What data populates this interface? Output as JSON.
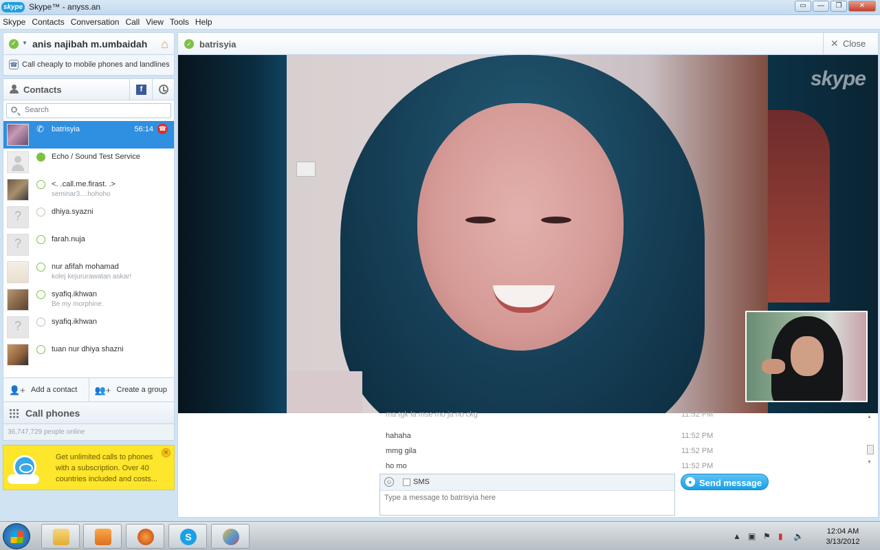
{
  "window": {
    "title": "Skype™ - anyss.an",
    "logo_text": "skype"
  },
  "menu": [
    "Skype",
    "Contacts",
    "Conversation",
    "Call",
    "View",
    "Tools",
    "Help"
  ],
  "profile": {
    "name": "anis najibah m.umbaidah"
  },
  "promo_call": {
    "text": "Call cheaply to mobile phones and landlines"
  },
  "contacts": {
    "label": "Contacts",
    "search_placeholder": "Search",
    "items": [
      {
        "name": "batrisyia",
        "mood": "",
        "timer": "56:14",
        "active": true,
        "avatar": "photo1",
        "status": "in-call"
      },
      {
        "name": "Echo / Sound Test Service",
        "mood": "",
        "avatar": "echo",
        "status": "online"
      },
      {
        "name": "<. .call.me.firast. .>",
        "mood": "seminar3....hohoho",
        "avatar": "photo2",
        "status": "offline"
      },
      {
        "name": "dhiya.syazni",
        "mood": "",
        "avatar": "q",
        "status": "unknown"
      },
      {
        "name": "farah.nuja",
        "mood": "",
        "avatar": "q",
        "status": "offline"
      },
      {
        "name": "nur afifah mohamad",
        "mood": "kolej kejururawatan askar!",
        "avatar": "photo3",
        "status": "offline"
      },
      {
        "name": "syafiq.ikhwan",
        "mood": "Be my morphine.",
        "avatar": "photo4",
        "status": "offline"
      },
      {
        "name": "syafiq.ikhwan",
        "mood": "",
        "avatar": "q",
        "status": "unknown"
      },
      {
        "name": "tuan nur dhiya shazni",
        "mood": "",
        "avatar": "photo5",
        "status": "offline"
      }
    ]
  },
  "actions": {
    "add_contact": "Add a contact",
    "create_group": "Create a group"
  },
  "call_phones": {
    "label": "Call phones",
    "online_count": "36,747,729 people online"
  },
  "subscription_promo": {
    "text": "Get unlimited calls to phones with a subscription. Over 40 countries included and costs..."
  },
  "conversation": {
    "contact": "batrisyia",
    "close_label": "Close",
    "video_brand": "skype",
    "messages": [
      {
        "text": "ma tgk la mse mo ja no ckg",
        "time": "11:52 PM",
        "faded": true
      },
      {
        "text": "hahaha",
        "time": "11:52 PM"
      },
      {
        "text": "mmg gila",
        "time": "11:52 PM"
      },
      {
        "text": "ho mo",
        "time": "11:52 PM"
      }
    ],
    "sms_label": "SMS",
    "input_placeholder": "Type a message to batrisyia here",
    "send_label": "Send message"
  },
  "taskbar": {
    "time": "12:04 AM",
    "date": "3/13/2012"
  },
  "colors": {
    "accent": "#2f8fe0",
    "online": "#7cc242",
    "promo": "#fde62b",
    "send": "#1aa0e8"
  }
}
